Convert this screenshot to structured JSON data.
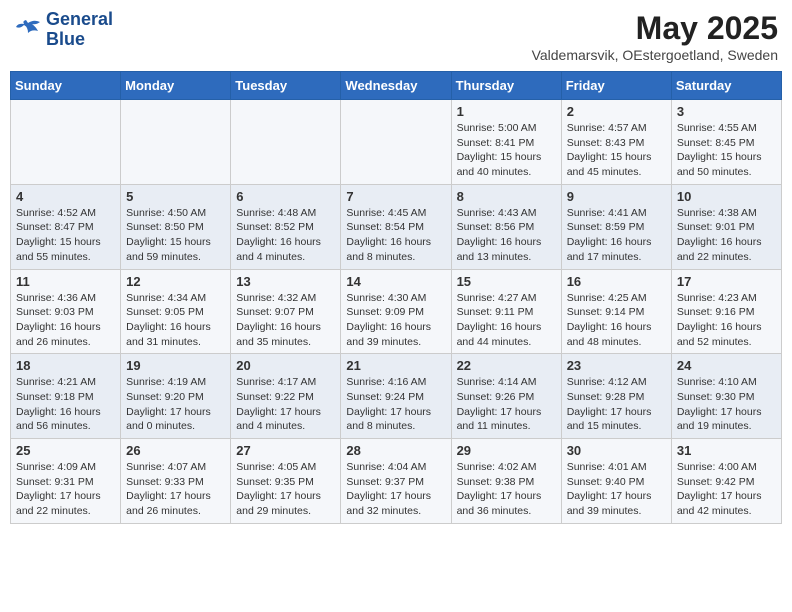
{
  "header": {
    "logo_line1": "General",
    "logo_line2": "Blue",
    "month_year": "May 2025",
    "location": "Valdemarsvik, OEstergoetland, Sweden"
  },
  "weekdays": [
    "Sunday",
    "Monday",
    "Tuesday",
    "Wednesday",
    "Thursday",
    "Friday",
    "Saturday"
  ],
  "weeks": [
    [
      {
        "day": "",
        "info": ""
      },
      {
        "day": "",
        "info": ""
      },
      {
        "day": "",
        "info": ""
      },
      {
        "day": "",
        "info": ""
      },
      {
        "day": "1",
        "info": "Sunrise: 5:00 AM\nSunset: 8:41 PM\nDaylight: 15 hours\nand 40 minutes."
      },
      {
        "day": "2",
        "info": "Sunrise: 4:57 AM\nSunset: 8:43 PM\nDaylight: 15 hours\nand 45 minutes."
      },
      {
        "day": "3",
        "info": "Sunrise: 4:55 AM\nSunset: 8:45 PM\nDaylight: 15 hours\nand 50 minutes."
      }
    ],
    [
      {
        "day": "4",
        "info": "Sunrise: 4:52 AM\nSunset: 8:47 PM\nDaylight: 15 hours\nand 55 minutes."
      },
      {
        "day": "5",
        "info": "Sunrise: 4:50 AM\nSunset: 8:50 PM\nDaylight: 15 hours\nand 59 minutes."
      },
      {
        "day": "6",
        "info": "Sunrise: 4:48 AM\nSunset: 8:52 PM\nDaylight: 16 hours\nand 4 minutes."
      },
      {
        "day": "7",
        "info": "Sunrise: 4:45 AM\nSunset: 8:54 PM\nDaylight: 16 hours\nand 8 minutes."
      },
      {
        "day": "8",
        "info": "Sunrise: 4:43 AM\nSunset: 8:56 PM\nDaylight: 16 hours\nand 13 minutes."
      },
      {
        "day": "9",
        "info": "Sunrise: 4:41 AM\nSunset: 8:59 PM\nDaylight: 16 hours\nand 17 minutes."
      },
      {
        "day": "10",
        "info": "Sunrise: 4:38 AM\nSunset: 9:01 PM\nDaylight: 16 hours\nand 22 minutes."
      }
    ],
    [
      {
        "day": "11",
        "info": "Sunrise: 4:36 AM\nSunset: 9:03 PM\nDaylight: 16 hours\nand 26 minutes."
      },
      {
        "day": "12",
        "info": "Sunrise: 4:34 AM\nSunset: 9:05 PM\nDaylight: 16 hours\nand 31 minutes."
      },
      {
        "day": "13",
        "info": "Sunrise: 4:32 AM\nSunset: 9:07 PM\nDaylight: 16 hours\nand 35 minutes."
      },
      {
        "day": "14",
        "info": "Sunrise: 4:30 AM\nSunset: 9:09 PM\nDaylight: 16 hours\nand 39 minutes."
      },
      {
        "day": "15",
        "info": "Sunrise: 4:27 AM\nSunset: 9:11 PM\nDaylight: 16 hours\nand 44 minutes."
      },
      {
        "day": "16",
        "info": "Sunrise: 4:25 AM\nSunset: 9:14 PM\nDaylight: 16 hours\nand 48 minutes."
      },
      {
        "day": "17",
        "info": "Sunrise: 4:23 AM\nSunset: 9:16 PM\nDaylight: 16 hours\nand 52 minutes."
      }
    ],
    [
      {
        "day": "18",
        "info": "Sunrise: 4:21 AM\nSunset: 9:18 PM\nDaylight: 16 hours\nand 56 minutes."
      },
      {
        "day": "19",
        "info": "Sunrise: 4:19 AM\nSunset: 9:20 PM\nDaylight: 17 hours\nand 0 minutes."
      },
      {
        "day": "20",
        "info": "Sunrise: 4:17 AM\nSunset: 9:22 PM\nDaylight: 17 hours\nand 4 minutes."
      },
      {
        "day": "21",
        "info": "Sunrise: 4:16 AM\nSunset: 9:24 PM\nDaylight: 17 hours\nand 8 minutes."
      },
      {
        "day": "22",
        "info": "Sunrise: 4:14 AM\nSunset: 9:26 PM\nDaylight: 17 hours\nand 11 minutes."
      },
      {
        "day": "23",
        "info": "Sunrise: 4:12 AM\nSunset: 9:28 PM\nDaylight: 17 hours\nand 15 minutes."
      },
      {
        "day": "24",
        "info": "Sunrise: 4:10 AM\nSunset: 9:30 PM\nDaylight: 17 hours\nand 19 minutes."
      }
    ],
    [
      {
        "day": "25",
        "info": "Sunrise: 4:09 AM\nSunset: 9:31 PM\nDaylight: 17 hours\nand 22 minutes."
      },
      {
        "day": "26",
        "info": "Sunrise: 4:07 AM\nSunset: 9:33 PM\nDaylight: 17 hours\nand 26 minutes."
      },
      {
        "day": "27",
        "info": "Sunrise: 4:05 AM\nSunset: 9:35 PM\nDaylight: 17 hours\nand 29 minutes."
      },
      {
        "day": "28",
        "info": "Sunrise: 4:04 AM\nSunset: 9:37 PM\nDaylight: 17 hours\nand 32 minutes."
      },
      {
        "day": "29",
        "info": "Sunrise: 4:02 AM\nSunset: 9:38 PM\nDaylight: 17 hours\nand 36 minutes."
      },
      {
        "day": "30",
        "info": "Sunrise: 4:01 AM\nSunset: 9:40 PM\nDaylight: 17 hours\nand 39 minutes."
      },
      {
        "day": "31",
        "info": "Sunrise: 4:00 AM\nSunset: 9:42 PM\nDaylight: 17 hours\nand 42 minutes."
      }
    ]
  ]
}
